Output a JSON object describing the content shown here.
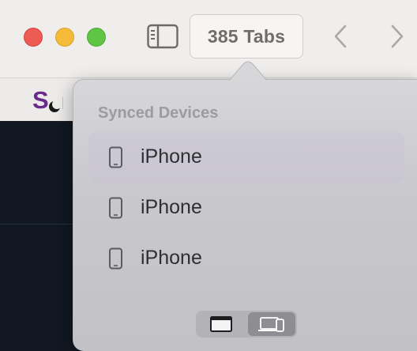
{
  "toolbar": {
    "tabs_count_label": "385 Tabs",
    "icons": [
      "sidebar-icon",
      "chevron-left-icon",
      "chevron-right-icon"
    ]
  },
  "colors": {
    "close": "#ee5b54",
    "minimize": "#f4bb38",
    "zoom": "#5ec545",
    "logo_purple": "#6a2a8c"
  },
  "popover": {
    "section_title": "Synced Devices",
    "devices": [
      {
        "label": "iPhone",
        "icon": "iphone-icon"
      },
      {
        "label": "iPhone",
        "icon": "iphone-icon"
      },
      {
        "label": "iPhone",
        "icon": "iphone-icon"
      }
    ],
    "segments": [
      {
        "icon": "browser-window-icon",
        "selected": false
      },
      {
        "icon": "devices-icon",
        "selected": true
      }
    ]
  }
}
